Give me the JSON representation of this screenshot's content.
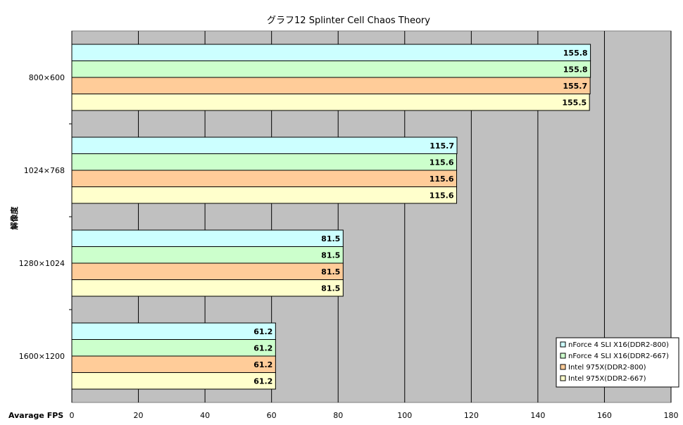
{
  "chart_data": {
    "type": "bar",
    "orientation": "horizontal",
    "title": "グラフ12  Splinter Cell Chaos Theory",
    "xlabel": "Avarage FPS",
    "ylabel": "解像度",
    "xlim": [
      0,
      180
    ],
    "x_ticks": [
      "0",
      "20",
      "40",
      "60",
      "80",
      "100",
      "120",
      "140",
      "160",
      "180"
    ],
    "categories": [
      "800×600",
      "1024×768",
      "1280×1024",
      "1600×1200"
    ],
    "grid": true,
    "legend_position": "bottom-right",
    "series": [
      {
        "name": "nForce 4 SLI X16(DDR2-800)",
        "color": "#ccffff",
        "values": [
          155.8,
          115.7,
          81.5,
          61.2
        ]
      },
      {
        "name": "nForce 4 SLI X16(DDR2-667)",
        "color": "#ccffcc",
        "values": [
          155.8,
          115.6,
          81.5,
          61.2
        ]
      },
      {
        "name": "Intel 975X(DDR2-800)",
        "color": "#ffcc99",
        "values": [
          155.7,
          115.6,
          81.5,
          61.2
        ]
      },
      {
        "name": "Intel 975X(DDR2-667)",
        "color": "#ffffcc",
        "values": [
          155.5,
          115.6,
          81.5,
          61.2
        ]
      }
    ],
    "plot_background": "#c0c0c0"
  }
}
